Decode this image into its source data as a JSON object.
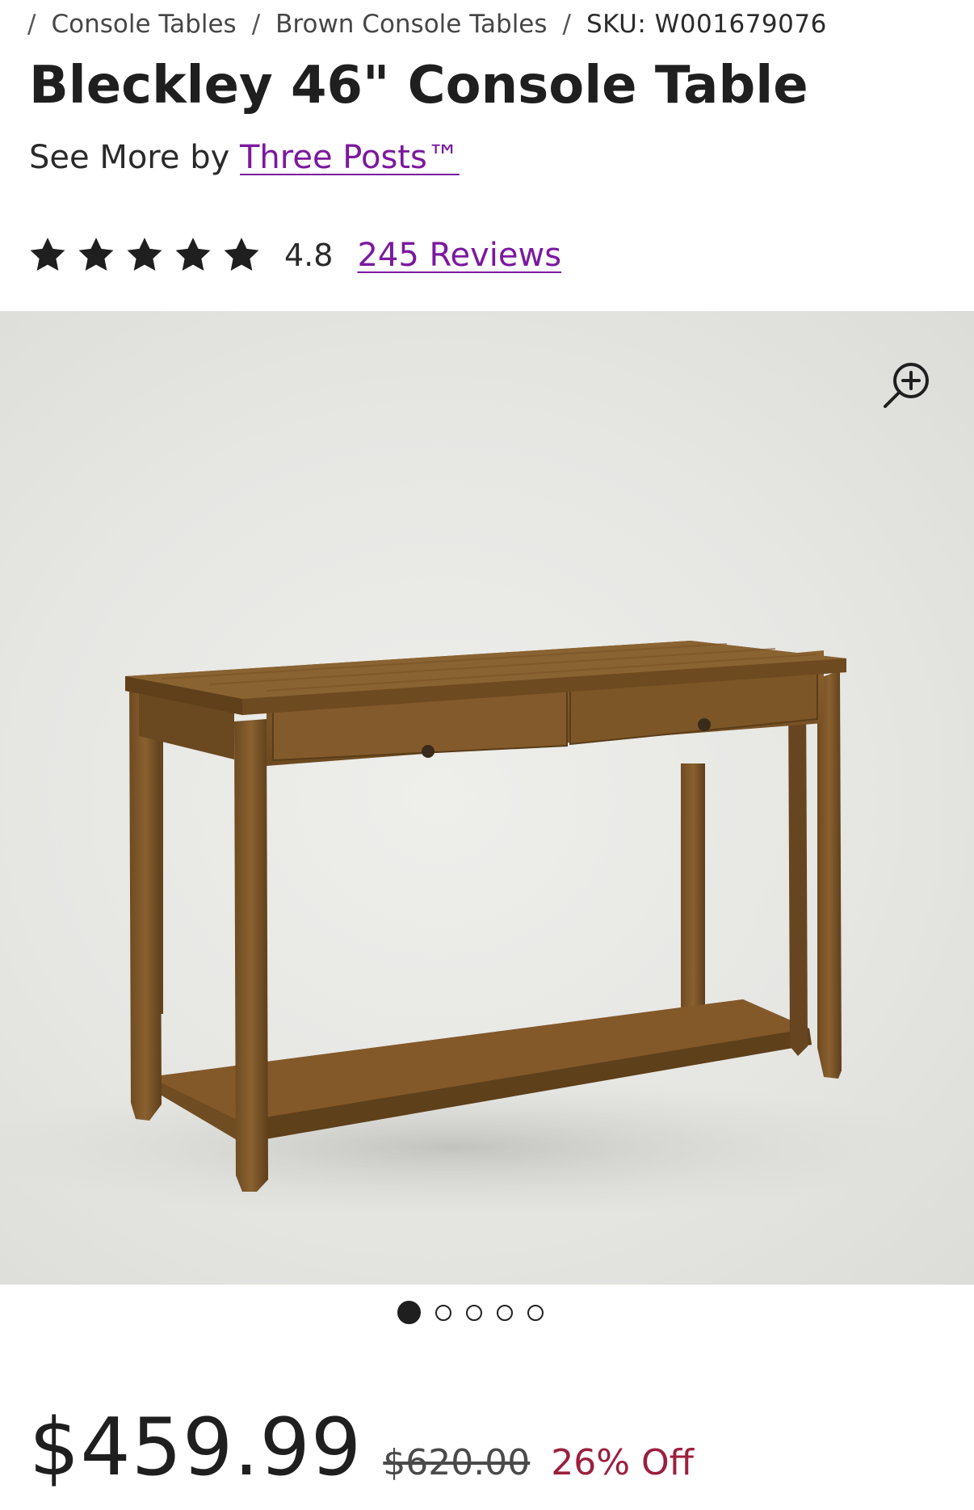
{
  "breadcrumb": {
    "items": [
      "Console Tables",
      "Brown Console Tables"
    ],
    "sku": "SKU: W001679076",
    "separator": "/"
  },
  "product": {
    "title": "Bleckley 46\" Console Table",
    "see_more_prefix": "See More by",
    "brand": "Three Posts™"
  },
  "rating": {
    "value": "4.8",
    "stars": 5,
    "reviews_label": "245 Reviews"
  },
  "gallery": {
    "image_icon": "zoom-in-icon",
    "total_images": 5,
    "active_index": 0
  },
  "price": {
    "current": "$459.99",
    "original": "$620.00",
    "discount": "26% Off"
  },
  "colors": {
    "link": "#7b189f",
    "discount": "#9c1f3d",
    "text": "#1f1f1f"
  }
}
